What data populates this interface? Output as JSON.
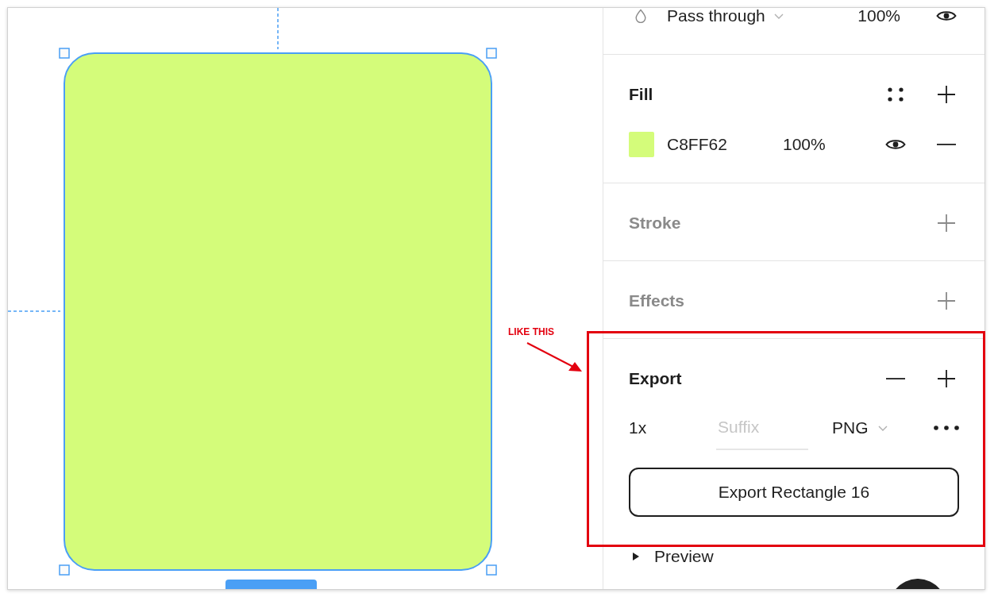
{
  "canvas": {
    "shape": {
      "color": "#d4fc7a",
      "selected": true
    }
  },
  "layer": {
    "blend_mode": "Pass through",
    "opacity": "100%",
    "visible": true
  },
  "sections": [
    {
      "kind": "fill",
      "title": "Fill",
      "active": true,
      "items": [
        {
          "color": "#d4fc7a",
          "hex": "C8FF62",
          "opacity": "100%",
          "visible": true
        }
      ]
    },
    {
      "kind": "stroke",
      "title": "Stroke",
      "active": false
    },
    {
      "kind": "effects",
      "title": "Effects",
      "active": false
    },
    {
      "kind": "export",
      "title": "Export",
      "active": true,
      "settings": [
        {
          "scale": "1x",
          "suffix": {
            "placeholder": "Suffix"
          },
          "format": "PNG"
        }
      ],
      "button": "Export Rectangle 16",
      "preview": {
        "label": "Preview",
        "expanded": false
      }
    }
  ],
  "annotation": {
    "label": "LIKE THIS"
  }
}
